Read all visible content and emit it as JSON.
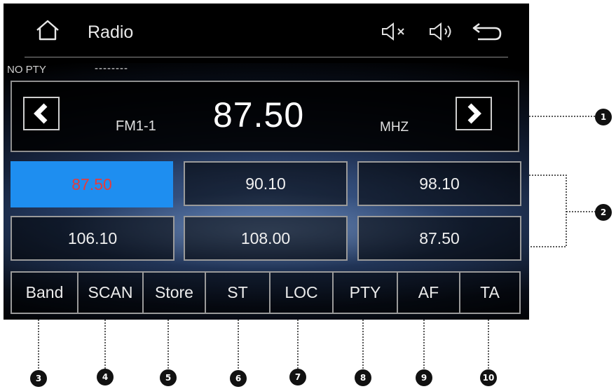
{
  "header": {
    "title": "Radio",
    "icons": [
      "home-icon",
      "mute-icon",
      "volume-icon",
      "back-icon"
    ]
  },
  "pty": {
    "label": "NO PTY",
    "value": "--------"
  },
  "tuner": {
    "band": "FM1-1",
    "frequency": "87.50",
    "unit": "MHZ",
    "prev_icon": "chevron-left-icon",
    "next_icon": "chevron-right-icon"
  },
  "presets": [
    {
      "label": "87.50",
      "active": true
    },
    {
      "label": "90.10"
    },
    {
      "label": "98.10"
    },
    {
      "label": "106.10"
    },
    {
      "label": "108.00"
    },
    {
      "label": "87.50"
    }
  ],
  "functions": [
    {
      "label": "Band"
    },
    {
      "label": "SCAN"
    },
    {
      "label": "Store"
    },
    {
      "label": "ST"
    },
    {
      "label": "LOC"
    },
    {
      "label": "PTY"
    },
    {
      "label": "AF"
    },
    {
      "label": "TA"
    }
  ],
  "callouts": [
    "1",
    "2",
    "3",
    "4",
    "5",
    "6",
    "7",
    "8",
    "9",
    "10"
  ],
  "colors": {
    "active_preset_bg": "#1e8ef0",
    "active_preset_text": "#e53c3c",
    "screen_bg": "#000000",
    "border": "#9a9a9a"
  }
}
